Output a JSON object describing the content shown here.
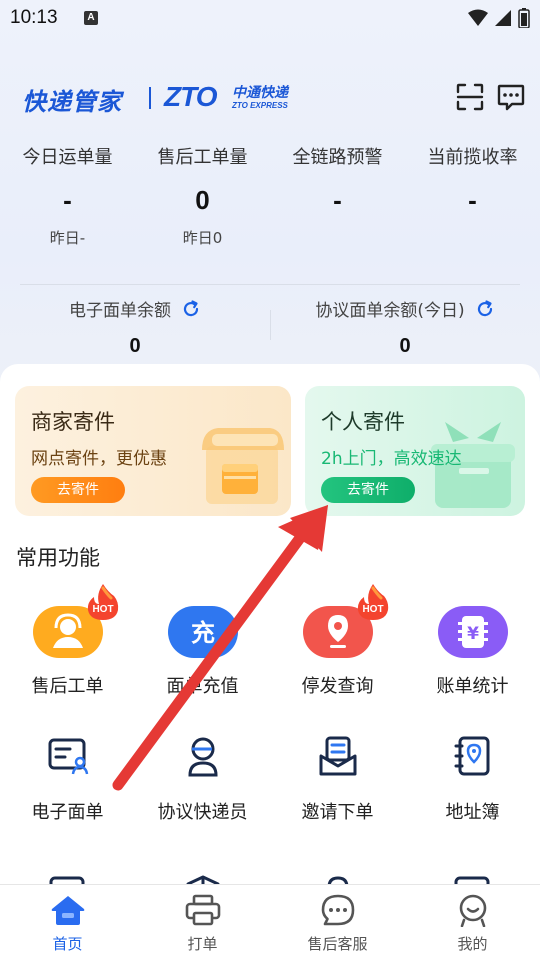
{
  "status_bar": {
    "time": "10:13",
    "notif_badge": "A"
  },
  "header": {
    "logo_text": "快递管家",
    "partner_mark": "ZTO",
    "partner_cn": "中通快递",
    "partner_en": "ZTO EXPRESS",
    "icons": [
      "scan-icon",
      "message-icon"
    ]
  },
  "stats": [
    {
      "label": "今日运单量",
      "value": "-",
      "sub": "昨日-"
    },
    {
      "label": "售后工单量",
      "value": "0",
      "sub": "昨日0"
    },
    {
      "label": "全链路预警",
      "value": "-",
      "sub": ""
    },
    {
      "label": "当前揽收率",
      "value": "-",
      "sub": ""
    }
  ],
  "balances": [
    {
      "label": "电子面单余额",
      "value": "0"
    },
    {
      "label": "协议面单余额(今日)",
      "value": "0"
    }
  ],
  "promos": {
    "merchant": {
      "title": "商家寄件",
      "subtitle": "网点寄件，更优惠",
      "button": "去寄件"
    },
    "personal": {
      "title": "个人寄件",
      "subtitle": "2h上门，高效速达",
      "button": "去寄件"
    }
  },
  "section_title": "常用功能",
  "features": [
    {
      "label": "售后工单",
      "icon": "headset-icon",
      "hot": true
    },
    {
      "label": "面单充值",
      "icon": "recharge-icon",
      "hot": false
    },
    {
      "label": "停发查询",
      "icon": "location-pin-icon",
      "hot": true
    },
    {
      "label": "账单统计",
      "icon": "bill-icon",
      "hot": false
    },
    {
      "label": "电子面单",
      "icon": "e-waybill-icon",
      "hot": false
    },
    {
      "label": "协议快递员",
      "icon": "courier-icon",
      "hot": false
    },
    {
      "label": "邀请下单",
      "icon": "invite-order-icon",
      "hot": false
    },
    {
      "label": "地址簿",
      "icon": "address-book-icon",
      "hot": false
    }
  ],
  "hot_badge": "HOT",
  "recharge_glyph": "充",
  "bill_glyph": "¥",
  "bottom_nav": [
    {
      "label": "首页",
      "icon": "home-icon",
      "active": true
    },
    {
      "label": "打单",
      "icon": "printer-icon",
      "active": false
    },
    {
      "label": "售后客服",
      "icon": "support-chat-icon",
      "active": false
    },
    {
      "label": "我的",
      "icon": "profile-icon",
      "active": false
    }
  ],
  "colors": {
    "brand_blue": "#1b57d6",
    "active_nav": "#1b62e6",
    "orange": "#ff8a18",
    "green": "#19b874",
    "red_arrow": "#e53935"
  }
}
